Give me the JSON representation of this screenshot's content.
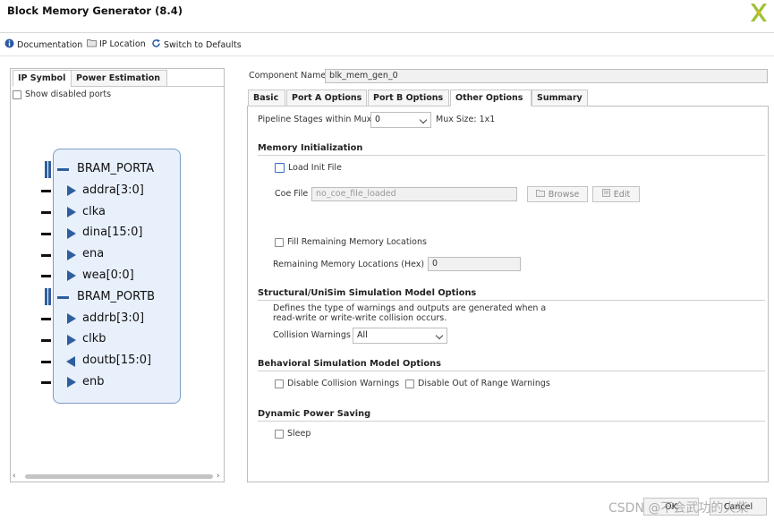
{
  "window": {
    "title": "Block Memory Generator (8.4)"
  },
  "toolbar": {
    "documentation": "Documentation",
    "ip_location": "IP Location",
    "switch_defaults": "Switch to Defaults"
  },
  "left_panel": {
    "tabs": [
      "IP Symbol",
      "Power Estimation"
    ],
    "show_disabled_ports": "Show disabled ports",
    "symbol": {
      "port_a": "BRAM_PORTA",
      "port_b": "BRAM_PORTB",
      "pins": [
        "addra[3:0]",
        "clka",
        "dina[15:0]",
        "ena",
        "wea[0:0]",
        "addrb[3:0]",
        "clkb",
        "doutb[15:0]",
        "enb"
      ]
    }
  },
  "component": {
    "label": "Component Name",
    "value": "blk_mem_gen_0"
  },
  "tabs": [
    "Basic",
    "Port A Options",
    "Port B Options",
    "Other Options",
    "Summary"
  ],
  "other_options": {
    "pipeline_label": "Pipeline Stages within Mux",
    "pipeline_value": "0",
    "mux_size": "Mux Size: 1x1",
    "mem_init": {
      "title": "Memory Initialization",
      "load_init": "Load Init File",
      "coe_label": "Coe File",
      "coe_value": "no_coe_file_loaded",
      "browse": "Browse",
      "edit": "Edit",
      "fill_remaining": "Fill Remaining Memory Locations",
      "remaining_label": "Remaining Memory Locations (Hex)",
      "remaining_value": "0"
    },
    "structural": {
      "title": "Structural/UniSim Simulation Model Options",
      "desc1": "Defines the type of warnings and outputs are generated when a",
      "desc2": "read-write or write-write collision occurs.",
      "collision_label": "Collision Warnings",
      "collision_value": "All"
    },
    "behavioral": {
      "title": "Behavioral Simulation Model Options",
      "disable_collision": "Disable Collision Warnings",
      "disable_range": "Disable Out of Range Warnings"
    },
    "power": {
      "title": "Dynamic Power Saving",
      "sleep": "Sleep"
    }
  },
  "footer": {
    "ok": "OK",
    "cancel": "Cancel",
    "watermark": "CSDN @不会武功的火柴"
  }
}
